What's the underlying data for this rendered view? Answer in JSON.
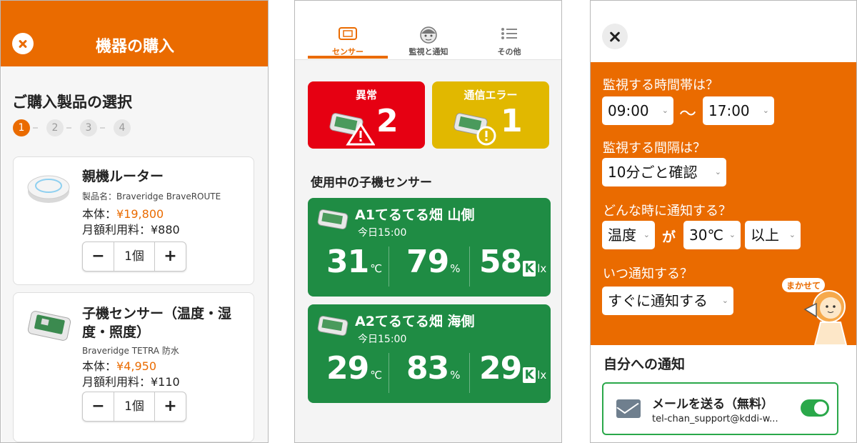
{
  "purchase": {
    "title": "機器の購入",
    "section_title": "ご購入製品の選択",
    "steps": [
      "1",
      "2",
      "3",
      "4"
    ],
    "products": [
      {
        "name": "親機ルーター",
        "model": "製品名：Braveridge BraveROUTE",
        "price_label": "本体：",
        "price": "¥19,800",
        "fee": "月額利用料：¥880",
        "quantity": "1個"
      },
      {
        "name_line1": "子機センサー（温度・湿",
        "name_line2": "度・照度）",
        "model": "Braveridge TETRA 防水",
        "price_label": "本体：",
        "price": "¥4,950",
        "fee": "月額利用料：¥110",
        "quantity": "1個"
      }
    ],
    "minus": "−",
    "plus": "+"
  },
  "dashboard": {
    "tabs": [
      {
        "label": "センサー",
        "icon": "sensor-icon",
        "active": true
      },
      {
        "label": "監視と通知",
        "icon": "face-icon"
      },
      {
        "label": "その他",
        "icon": "list-icon"
      }
    ],
    "alerts": [
      {
        "title": "異常",
        "count": "2",
        "color": "#e60012"
      },
      {
        "title": "通信エラー",
        "count": "1",
        "color": "#e1b800"
      }
    ],
    "section_title": "使用中の子機センサー",
    "sensors": [
      {
        "name": "A1てるてる畑 山側",
        "time": "今日15:00",
        "temp": "31",
        "temp_unit": "℃",
        "humidity": "79",
        "hum_unit": "%",
        "lux": "58",
        "k": "K",
        "lux_unit": "lx"
      },
      {
        "name": "A2てるてる畑 海側",
        "time": "今日15:00",
        "temp": "29",
        "temp_unit": "℃",
        "humidity": "83",
        "hum_unit": "%",
        "lux": "29",
        "k": "K",
        "lux_unit": "lx"
      }
    ]
  },
  "monitor": {
    "q_time": "監視する時間帯は？",
    "time_from": "09:00",
    "tilde": "〜",
    "time_to": "17:00",
    "q_interval": "監視する間隔は？",
    "interval": "10分ごと確認",
    "q_condition": "どんな時に通知する？",
    "metric": "温度",
    "ga": "が",
    "threshold": "30℃",
    "comparison": "以上",
    "q_when": "いつ通知する？",
    "when": "すぐに通知する",
    "mascot_label": "まかせて",
    "notify_title": "自分への通知",
    "mail_title": "メールを送る（無料）",
    "mail_address": "tel-chan_support@kddi-w...",
    "mail_enabled": true
  },
  "colors": {
    "orange": "#ea6b00",
    "green": "#1f8c44",
    "red": "#e60012",
    "yellow": "#e1b800"
  }
}
